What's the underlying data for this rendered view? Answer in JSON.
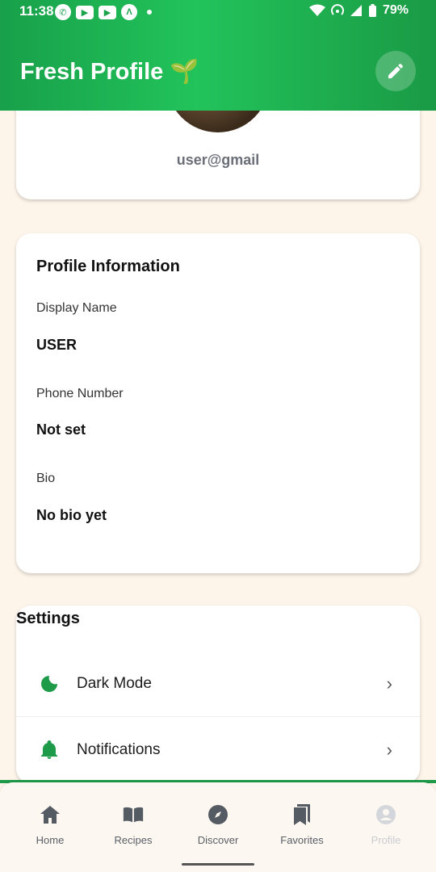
{
  "status_bar": {
    "time": "11:38",
    "battery": "79%"
  },
  "header": {
    "title": "Fresh Profile 🌱"
  },
  "profile": {
    "email": "user@gmail"
  },
  "info": {
    "title": "Profile Information",
    "fields": [
      {
        "label": "Display Name",
        "value": "USER"
      },
      {
        "label": "Phone Number",
        "value": "Not set"
      },
      {
        "label": "Bio",
        "value": "No bio yet"
      }
    ]
  },
  "settings": {
    "title": "Settings",
    "items": [
      {
        "label": "Dark Mode",
        "icon": "moon-icon"
      },
      {
        "label": "Notifications",
        "icon": "bell-icon"
      }
    ]
  },
  "nav": [
    {
      "label": "Home",
      "icon": "home-icon"
    },
    {
      "label": "Recipes",
      "icon": "book-icon"
    },
    {
      "label": "Discover",
      "icon": "compass-icon"
    },
    {
      "label": "Favorites",
      "icon": "bookmark-icon"
    },
    {
      "label": "Profile",
      "icon": "person-icon",
      "disabled": true
    }
  ],
  "colors": {
    "accent": "#1d9b48",
    "background": "#fdf4ea"
  }
}
